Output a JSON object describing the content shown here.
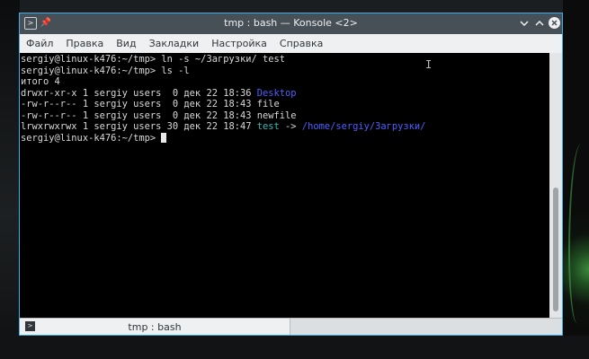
{
  "window": {
    "title": "tmp : bash — Konsole <2>"
  },
  "menu": [
    "Файл",
    "Правка",
    "Вид",
    "Закладки",
    "Настройка",
    "Справка"
  ],
  "terminal": {
    "lines": [
      {
        "parts": [
          {
            "text": "sergiy@linux-k476:~/tmp> ln -s ~/Загрузки/ test",
            "style": "normal"
          }
        ]
      },
      {
        "parts": [
          {
            "text": "sergiy@linux-k476:~/tmp> ls -l",
            "style": "normal"
          }
        ]
      },
      {
        "parts": [
          {
            "text": "итого 4",
            "style": "normal"
          }
        ]
      },
      {
        "parts": [
          {
            "text": "drwxr-xr-x 1 sergiy users  0 дек 22 18:36 ",
            "style": "normal"
          },
          {
            "text": "Desktop",
            "style": "dir"
          }
        ]
      },
      {
        "parts": [
          {
            "text": "-rw-r--r-- 1 sergiy users  0 дек 22 18:43 file",
            "style": "normal"
          }
        ]
      },
      {
        "parts": [
          {
            "text": "-rw-r--r-- 1 sergiy users  0 дек 22 18:43 newfile",
            "style": "normal"
          }
        ]
      },
      {
        "parts": [
          {
            "text": "lrwxrwxrwx 1 sergiy users 30 дек 22 18:47 ",
            "style": "normal"
          },
          {
            "text": "test",
            "style": "link"
          },
          {
            "text": " -> ",
            "style": "normal"
          },
          {
            "text": "/home/sergiy/Загрузки/",
            "style": "target"
          }
        ]
      },
      {
        "parts": [
          {
            "text": "sergiy@linux-k476:~/tmp> ",
            "style": "normal"
          }
        ],
        "cursor": true
      }
    ],
    "scroll_position": 0.5
  },
  "tabs": [
    {
      "label": "tmp : bash"
    }
  ],
  "colors": {
    "titlebar": "#475057",
    "border_accent": "#3daee9",
    "dir": "#4f5fff",
    "link": "#3ab8b8"
  }
}
